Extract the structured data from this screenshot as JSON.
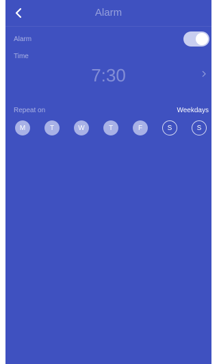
{
  "header": {
    "title": "Alarm",
    "back_icon": "chevron-left-icon"
  },
  "alarm": {
    "label": "Alarm",
    "enabled": true
  },
  "time": {
    "label": "Time",
    "value": "7:30",
    "chevron_icon": "chevron-right-icon"
  },
  "repeat": {
    "label": "Repeat on",
    "value": "Weekdays",
    "days": [
      {
        "letter": "M",
        "selected": true
      },
      {
        "letter": "T",
        "selected": true
      },
      {
        "letter": "W",
        "selected": true
      },
      {
        "letter": "T",
        "selected": true
      },
      {
        "letter": "F",
        "selected": true
      },
      {
        "letter": "S",
        "selected": false
      },
      {
        "letter": "S",
        "selected": false
      }
    ]
  },
  "colors": {
    "background": "#3f51c0",
    "accent": "#a8b1e6",
    "toggle_on": "#c8cef0"
  }
}
